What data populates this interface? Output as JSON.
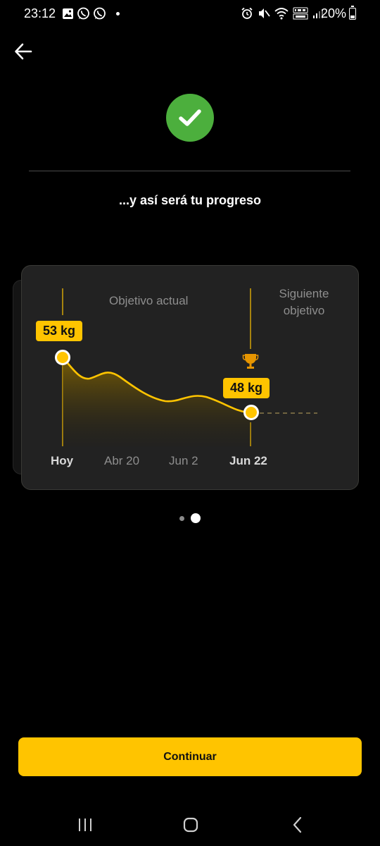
{
  "status_bar": {
    "time": "23:12",
    "left_icons": [
      "gallery-icon",
      "whatsapp-icon",
      "whatsapp-icon"
    ],
    "right_icons": [
      "alarm-icon",
      "mute-icon",
      "wifi-icon",
      "volte-icon",
      "signal-icon"
    ],
    "battery": "20%"
  },
  "header": {
    "back_icon": "arrow-left-icon",
    "badge_icon": "checkmark-icon",
    "badge_color": "#4caf3d"
  },
  "subtitle": "...y así será tu progreso",
  "chart": {
    "current_goal_label": "Objetivo actual",
    "next_goal_label": "Siguiente objetivo",
    "start_tag": "53 kg",
    "end_tag": "48 kg",
    "trophy_icon": "trophy-icon",
    "accent_color": "#ffc400"
  },
  "chart_data": {
    "type": "area",
    "x": [
      "Hoy",
      "Abr 20",
      "Jun 2",
      "Jun 22"
    ],
    "series": [
      {
        "values": [
          53,
          51.5,
          49.7,
          48
        ]
      }
    ],
    "annotations": [
      "53 kg",
      "48 kg"
    ],
    "grid": false
  },
  "pager": {
    "total": 2,
    "active": 2
  },
  "continue_button": {
    "label": "Continuar"
  },
  "nav_bar": {
    "items": [
      "recents-icon",
      "home-icon",
      "back-icon"
    ]
  }
}
